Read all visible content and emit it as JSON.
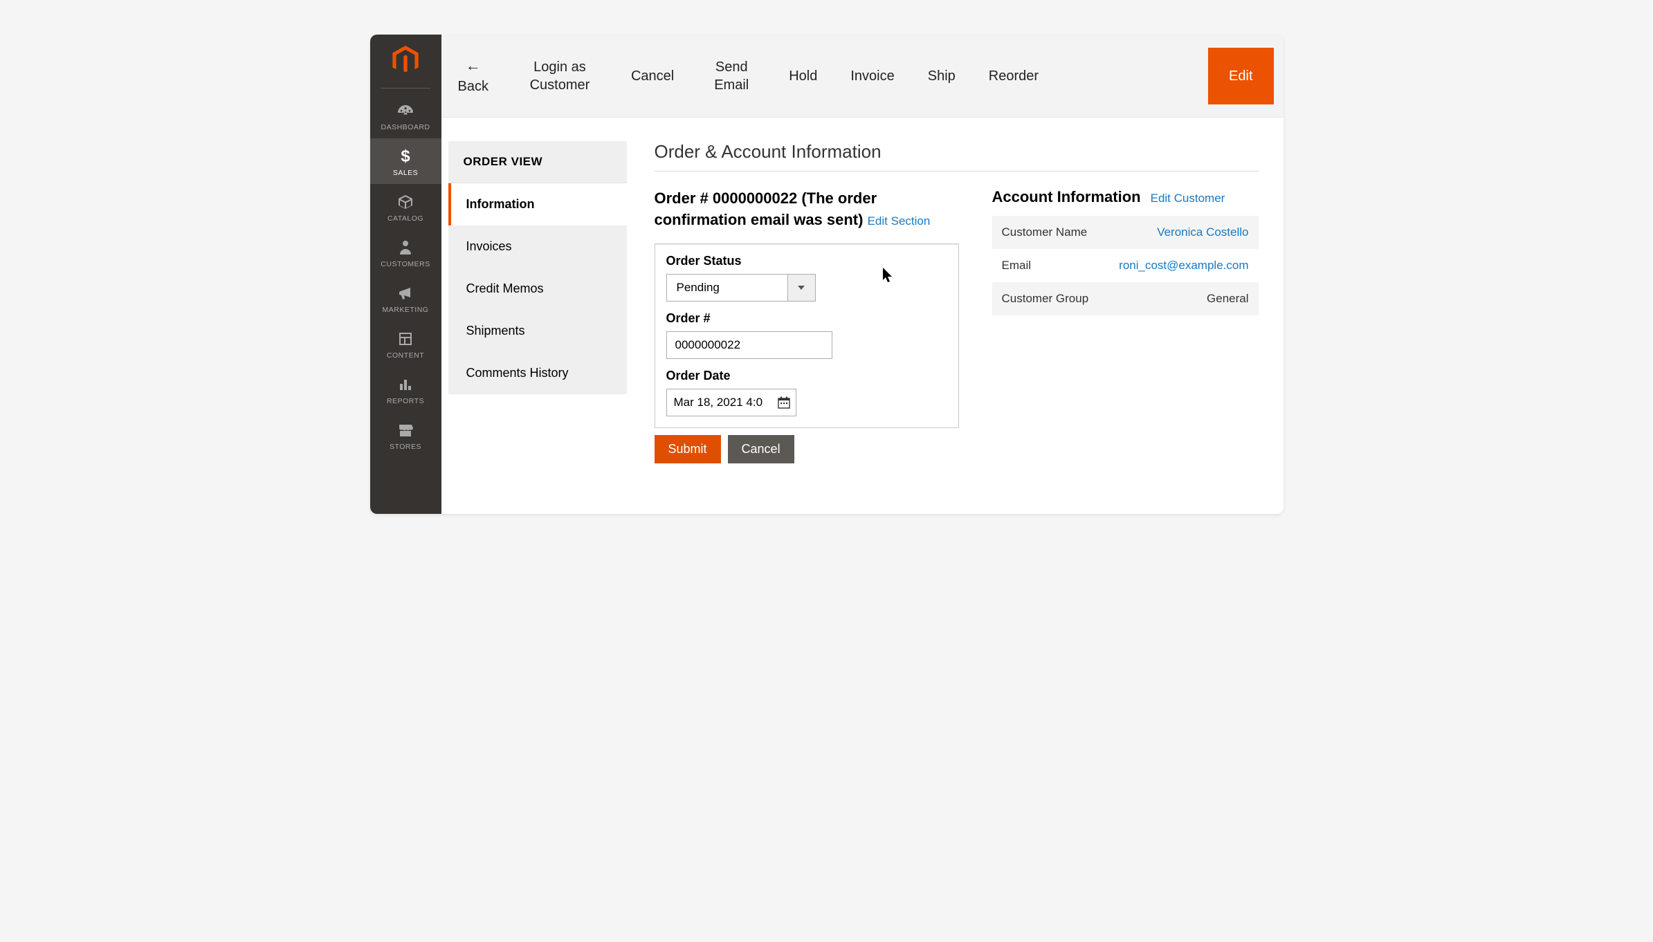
{
  "sidebar": {
    "items": [
      {
        "label": "DASHBOARD"
      },
      {
        "label": "SALES"
      },
      {
        "label": "CATALOG"
      },
      {
        "label": "CUSTOMERS"
      },
      {
        "label": "MARKETING"
      },
      {
        "label": "CONTENT"
      },
      {
        "label": "REPORTS"
      },
      {
        "label": "STORES"
      }
    ]
  },
  "toolbar": {
    "back": "Back",
    "login_as": "Login as Customer",
    "cancel": "Cancel",
    "send_email": "Send Email",
    "hold": "Hold",
    "invoice": "Invoice",
    "ship": "Ship",
    "reorder": "Reorder",
    "edit": "Edit"
  },
  "order_view": {
    "header": "ORDER VIEW",
    "items": [
      "Information",
      "Invoices",
      "Credit Memos",
      "Shipments",
      "Comments History"
    ]
  },
  "section_title": "Order & Account Information",
  "order": {
    "heading_prefix": "Order # ",
    "number": "0000000022",
    "heading_suffix": " (The order confirmation email was sent)",
    "edit_section": "Edit Section",
    "status_label": "Order Status",
    "status_value": "Pending",
    "ordernum_label": "Order #",
    "ordernum_value": "0000000022",
    "date_label": "Order Date",
    "date_value": "Mar 18, 2021 4:0",
    "submit": "Submit",
    "cancel": "Cancel"
  },
  "account": {
    "title": "Account Information",
    "edit_customer": "Edit Customer",
    "rows": [
      {
        "label": "Customer Name",
        "value": "Veronica Costello",
        "link": true
      },
      {
        "label": "Email",
        "value": "roni_cost@example.com",
        "link": true
      },
      {
        "label": "Customer Group",
        "value": "General",
        "link": false
      }
    ]
  }
}
